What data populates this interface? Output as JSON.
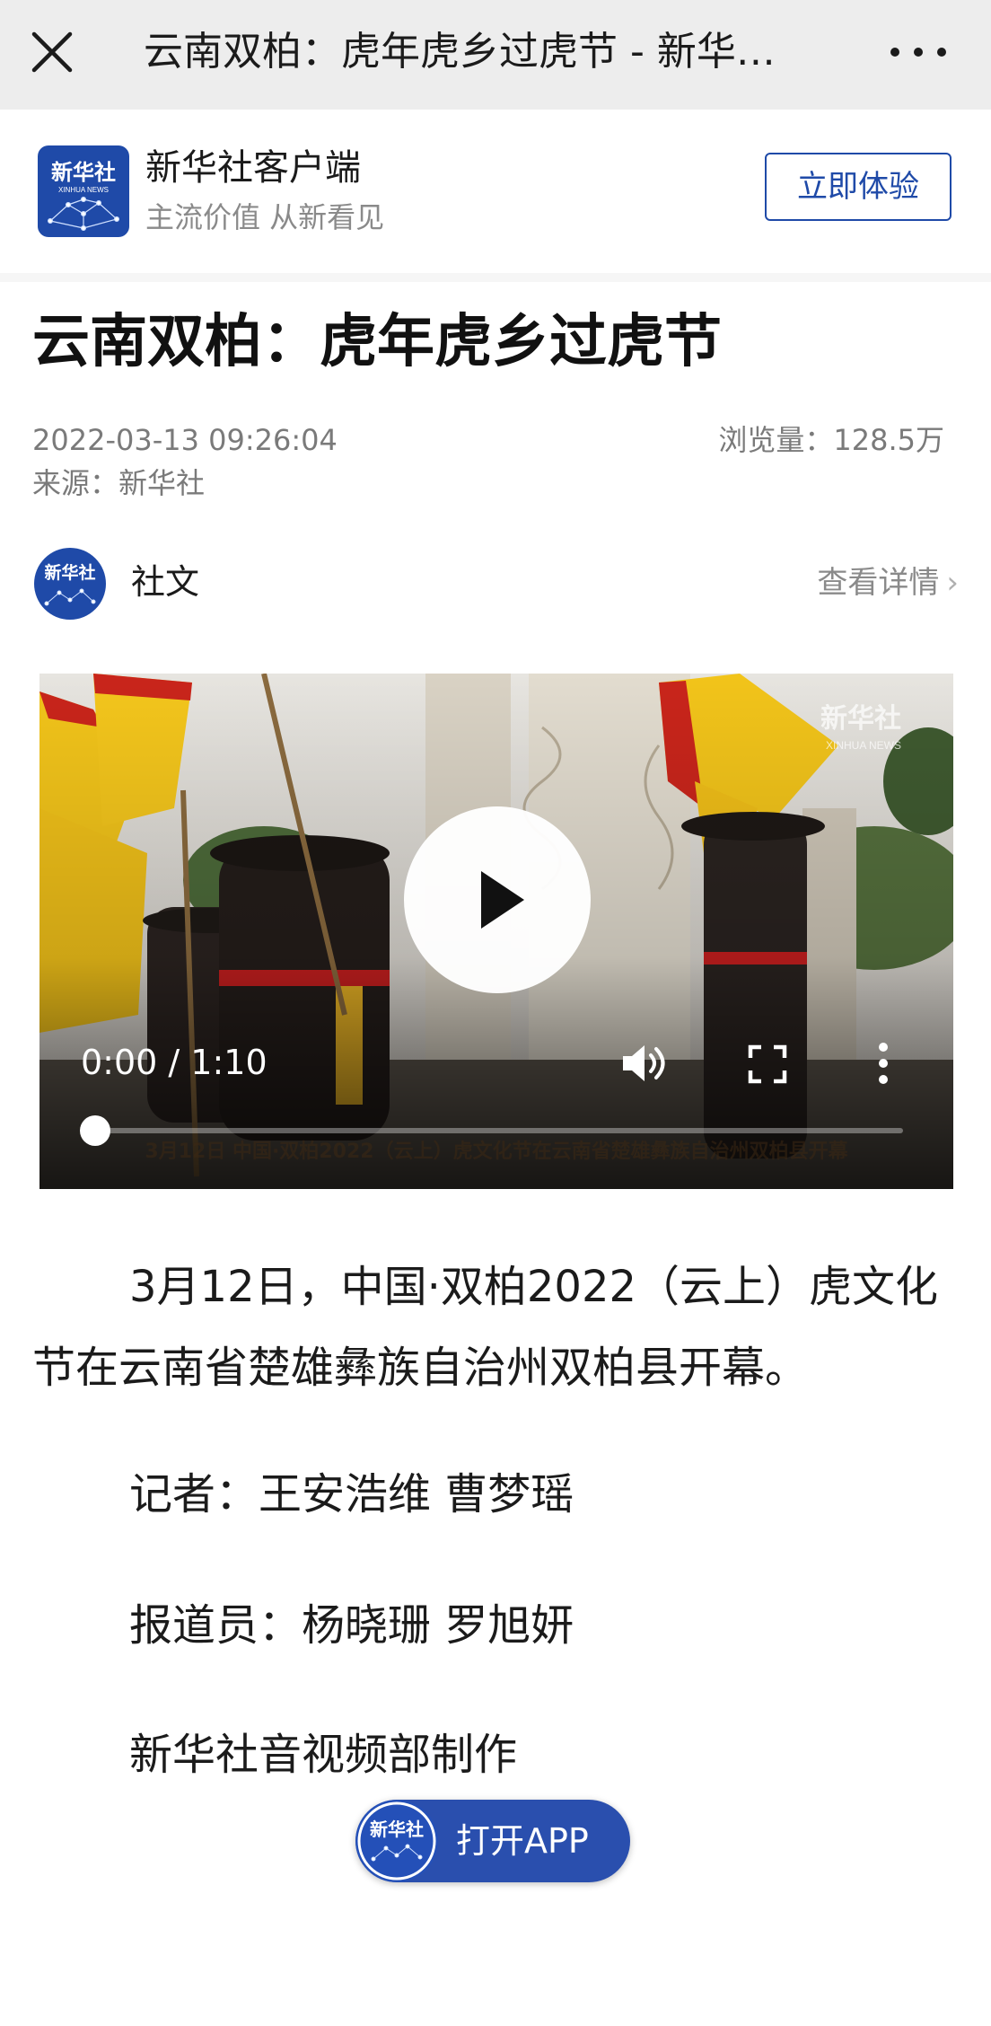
{
  "topbar": {
    "title": "云南双柏：虎年虎乡过虎节 - 新华…"
  },
  "banner": {
    "logo_text": "新华社",
    "logo_subtext": "XINHUA NEWS",
    "app_name": "新华社客户端",
    "slogan": "主流价值 从新看见",
    "cta_label": "立即体验"
  },
  "article": {
    "headline": "云南双柏：虎年虎乡过虎节",
    "date": "2022-03-13 09:26:04",
    "views": "浏览量：128.5万",
    "source": "来源：新华社"
  },
  "author": {
    "name": "社文",
    "details_label": "查看详情",
    "details_chevron": "›"
  },
  "video": {
    "time": "0:00 / 1:10",
    "progress": 0,
    "watermark": "新华社",
    "watermark_sub": "XINHUA NEWS",
    "caption": "3月12日 中国·双柏2022（云上）虎文化节在云南省楚雄彝族自治州双柏县开幕"
  },
  "body": {
    "paragraph": "3月12日，中国·双柏2022（云上）虎文化节在云南省楚雄彝族自治州双柏县开幕。",
    "reporters": "记者：王安浩维 曹梦瑶",
    "correspondents": "报道员：杨晓珊 罗旭妍",
    "producer": "新华社音视频部制作"
  },
  "open_app": {
    "label": "打开APP"
  },
  "colors": {
    "brand_blue": "#1f4aa8",
    "topbar_bg": "#ededed",
    "meta_gray": "#7a7a7a"
  }
}
